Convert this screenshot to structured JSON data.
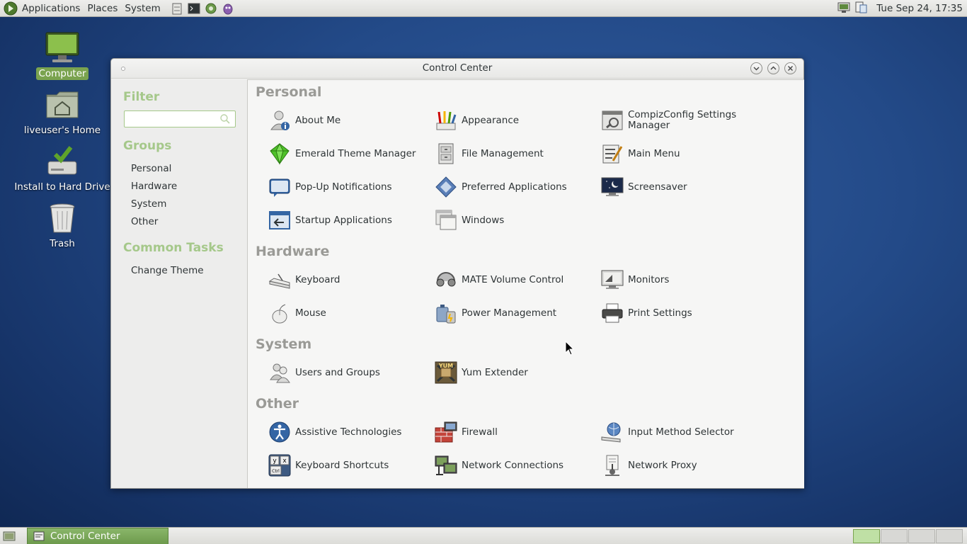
{
  "top_panel": {
    "menus": [
      "Applications",
      "Places",
      "System"
    ],
    "launchers": [
      "file-manager-icon",
      "terminal-icon",
      "network-icon",
      "pidgin-icon"
    ],
    "clock": "Tue Sep 24, 17:35"
  },
  "desktop": {
    "icons": [
      {
        "label": "Computer",
        "icon": "computer-icon"
      },
      {
        "label": "liveuser's Home",
        "icon": "home-folder-icon"
      },
      {
        "label": "Install to Hard Drive",
        "icon": "install-drive-icon"
      },
      {
        "label": "Trash",
        "icon": "trash-icon"
      }
    ]
  },
  "window": {
    "title": "Control Center",
    "sidebar": {
      "filter_heading": "Filter",
      "search_value": "",
      "groups_heading": "Groups",
      "groups": [
        "Personal",
        "Hardware",
        "System",
        "Other"
      ],
      "tasks_heading": "Common Tasks",
      "tasks": [
        "Change Theme"
      ]
    },
    "sections": [
      {
        "title": "Personal",
        "items": [
          {
            "label": "About Me",
            "icon": "about-me-icon"
          },
          {
            "label": "Appearance",
            "icon": "appearance-icon"
          },
          {
            "label": "CompizConfig Settings Manager",
            "icon": "compizconfig-icon"
          },
          {
            "label": "Emerald Theme Manager",
            "icon": "emerald-icon"
          },
          {
            "label": "File Management",
            "icon": "file-management-icon"
          },
          {
            "label": "Main Menu",
            "icon": "main-menu-icon"
          },
          {
            "label": "Pop-Up Notifications",
            "icon": "popup-notifications-icon"
          },
          {
            "label": "Preferred Applications",
            "icon": "preferred-applications-icon"
          },
          {
            "label": "Screensaver",
            "icon": "screensaver-icon"
          },
          {
            "label": "Startup Applications",
            "icon": "startup-applications-icon"
          },
          {
            "label": "Windows",
            "icon": "windows-icon"
          }
        ]
      },
      {
        "title": "Hardware",
        "items": [
          {
            "label": "Keyboard",
            "icon": "keyboard-icon"
          },
          {
            "label": "MATE Volume Control",
            "icon": "volume-control-icon"
          },
          {
            "label": "Monitors",
            "icon": "monitors-icon"
          },
          {
            "label": "Mouse",
            "icon": "mouse-icon"
          },
          {
            "label": "Power Management",
            "icon": "power-management-icon"
          },
          {
            "label": "Print Settings",
            "icon": "printer-icon"
          }
        ]
      },
      {
        "title": "System",
        "items": [
          {
            "label": "Users and Groups",
            "icon": "users-groups-icon"
          },
          {
            "label": "Yum Extender",
            "icon": "yum-extender-icon"
          }
        ]
      },
      {
        "title": "Other",
        "items": [
          {
            "label": "Assistive Technologies",
            "icon": "accessibility-icon"
          },
          {
            "label": "Firewall",
            "icon": "firewall-icon"
          },
          {
            "label": "Input Method Selector",
            "icon": "input-method-icon"
          },
          {
            "label": "Keyboard Shortcuts",
            "icon": "keyboard-shortcuts-icon"
          },
          {
            "label": "Network Connections",
            "icon": "network-connections-icon"
          },
          {
            "label": "Network Proxy",
            "icon": "network-proxy-icon"
          }
        ]
      }
    ]
  },
  "bottom_panel": {
    "task_label": "Control Center",
    "workspaces": 4,
    "active_workspace": 1
  },
  "colors": {
    "accent_green": "#7aa34f",
    "sidebar_heading": "#a5c88a",
    "section_heading": "#9a9a96"
  }
}
